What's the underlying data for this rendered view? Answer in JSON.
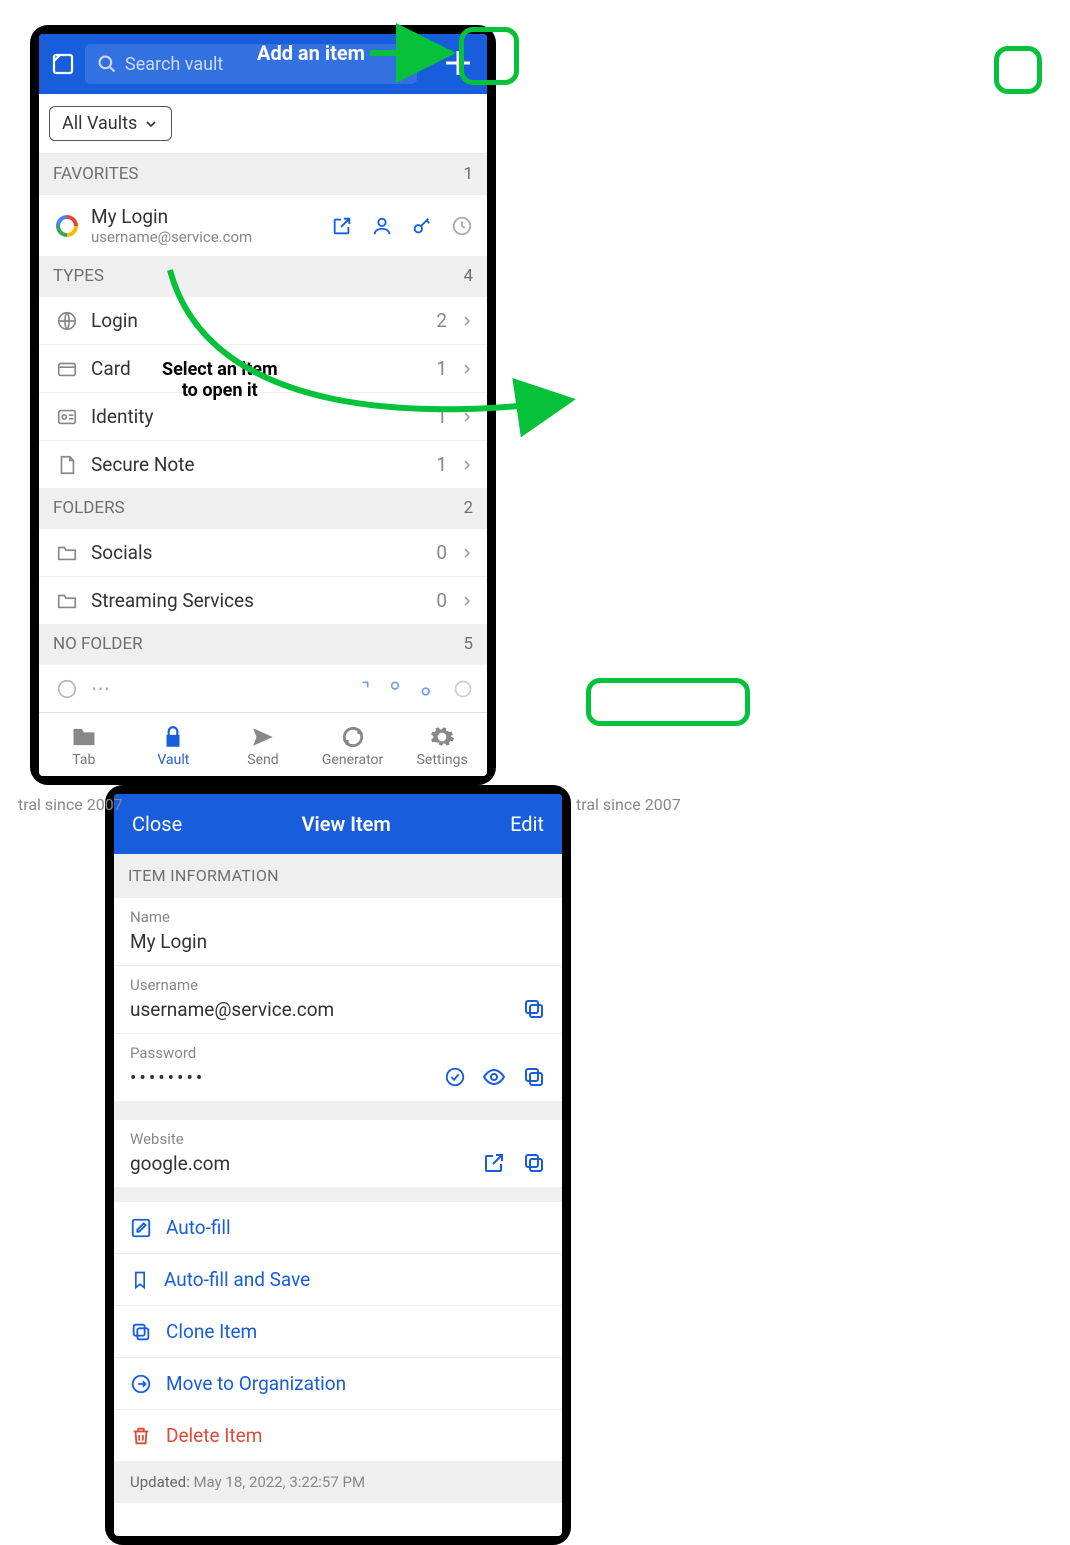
{
  "left": {
    "search_placeholder": "Search vault",
    "filter_label": "All Vaults",
    "favorites": {
      "title": "FAVORITES",
      "count": "1"
    },
    "fav_item": {
      "name": "My Login",
      "sub": "username@service.com"
    },
    "types": {
      "title": "TYPES",
      "count": "4",
      "items": [
        {
          "label": "Login",
          "count": "2"
        },
        {
          "label": "Card",
          "count": "1"
        },
        {
          "label": "Identity",
          "count": "1"
        },
        {
          "label": "Secure Note",
          "count": "1"
        }
      ]
    },
    "folders": {
      "title": "FOLDERS",
      "count": "2",
      "items": [
        {
          "label": "Socials",
          "count": "0"
        },
        {
          "label": "Streaming Services",
          "count": "0"
        }
      ]
    },
    "no_folder": {
      "title": "NO FOLDER",
      "count": "5"
    },
    "nav": {
      "tab": "Tab",
      "vault": "Vault",
      "send": "Send",
      "generator": "Generator",
      "settings": "Settings"
    }
  },
  "right": {
    "close": "Close",
    "title": "View Item",
    "edit": "Edit",
    "section": "ITEM INFORMATION",
    "name_label": "Name",
    "name_value": "My Login",
    "user_label": "Username",
    "user_value": "username@service.com",
    "pass_label": "Password",
    "pass_value": "••••••••",
    "site_label": "Website",
    "site_value": "google.com",
    "actions": {
      "autofill": "Auto-fill",
      "autofill_save": "Auto-fill and Save",
      "clone": "Clone Item",
      "move": "Move to Organization",
      "delete": "Delete Item"
    },
    "updated_label": "Updated:",
    "updated_value": " May 18, 2022, 3:22:57 PM"
  },
  "annotations": {
    "add_item": "Add an item",
    "select_item": "Select an item\nto open it"
  },
  "truncated_bg": "tral since 2007"
}
